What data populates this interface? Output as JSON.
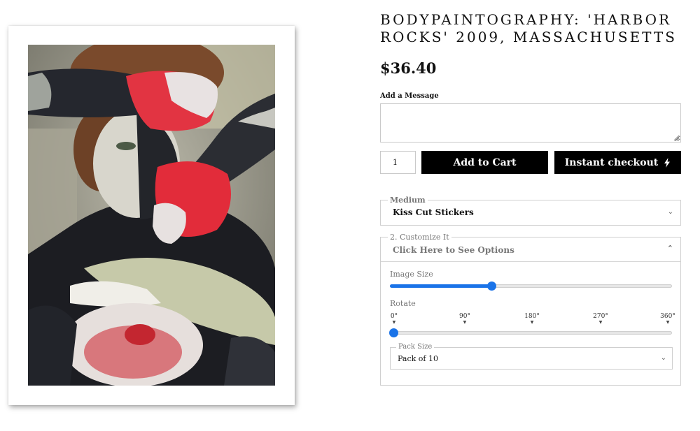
{
  "product": {
    "title": "BODYPAINTOGRAPHY: 'HARBOR ROCKS' 2009, MASSACHUSETTS",
    "price": "$36.40",
    "image_alt_icon": "artwork-image"
  },
  "message": {
    "label": "Add a Message",
    "value": "",
    "placeholder": ""
  },
  "purchase": {
    "quantity": "1",
    "add_to_cart_label": "Add to Cart",
    "instant_checkout_label": "Instant checkout",
    "instant_checkout_icon": "lightning-bolt-icon"
  },
  "medium": {
    "legend": "Medium",
    "selected": "Kiss Cut Stickers"
  },
  "customize": {
    "legend": "2. Customize It",
    "header_label": "Click Here to See Options",
    "image_size_label": "Image Size",
    "image_size_value": 0.36,
    "rotate_label": "Rotate",
    "rotate_value": "0°",
    "rotate_ticks": [
      "0°",
      "90°",
      "180°",
      "270°",
      "360°"
    ],
    "pack_size_legend": "Pack Size",
    "pack_size_selected": "Pack of 10"
  },
  "colors": {
    "accent": "#1a73e8",
    "button_bg": "#000000",
    "button_text": "#ffffff"
  }
}
